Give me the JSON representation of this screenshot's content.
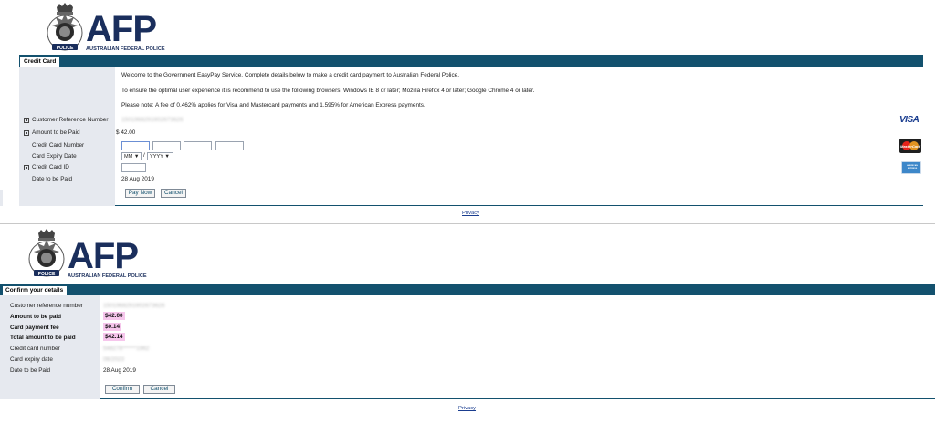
{
  "colors": {
    "brand_navy": "#1a2e5c",
    "tab_bar": "#13516e",
    "left_column": "#e6e9ef",
    "highlight": "#f6c6ec",
    "link": "#1a3d8f"
  },
  "logo": {
    "abbr": "AFP",
    "full": "AUSTRALIAN FEDERAL POLICE",
    "crest_label": "POLICE",
    "icon": "afp-crest-icon"
  },
  "payment_form": {
    "tab_label": "Credit Card",
    "info": [
      "Welcome to the Government EasyPay Service. Complete details below to make a credit card payment to Australian Federal Police.",
      "To ensure the optimal user experience it is recommend to use the following browsers: Windows IE 8 or later; Mozilla Firefox 4 or later; Google Chrome 4 or later.",
      "Please note: A fee of 0.462% applies for Visa and Mastercard payments and 1.595% for American Express payments."
    ],
    "fields": {
      "customer_reference": {
        "label": "Customer Reference Number",
        "value": "1501968291902673626"
      },
      "amount": {
        "label": "Amount to be Paid",
        "value": "$ 42.00"
      },
      "card_number": {
        "label": "Credit Card Number"
      },
      "expiry": {
        "label": "Card Expiry Date",
        "month_placeholder": "MM",
        "year_placeholder": "YYYY",
        "separator": "/"
      },
      "card_id": {
        "label": "Credit Card ID"
      },
      "date": {
        "label": "Date to be Paid",
        "value": "28 Aug 2019"
      }
    },
    "buttons": {
      "pay_now": "Pay Now",
      "cancel": "Cancel"
    },
    "cards": {
      "visa": "VISA",
      "mastercard": "MasterCard",
      "amex": "AMERICAN EXPRESS"
    },
    "privacy": "Privacy"
  },
  "confirm": {
    "tab_label": "Confirm your details",
    "rows": {
      "customer_reference": {
        "label": "Customer reference number",
        "value": "1501968291902673626"
      },
      "amount": {
        "label": "Amount to be paid",
        "value": "$42.00"
      },
      "fee": {
        "label": "Card payment fee",
        "value": "$0.14"
      },
      "total": {
        "label": "Total amount to be paid",
        "value": "$42.14"
      },
      "card_number": {
        "label": "Credit card number",
        "value": "548278******1962"
      },
      "expiry": {
        "label": "Card expiry date",
        "value": "06/2023"
      },
      "date": {
        "label": "Date to be Paid",
        "value": "28 Aug 2019"
      }
    },
    "buttons": {
      "confirm": "Confirm",
      "cancel": "Cancel"
    },
    "privacy": "Privacy"
  }
}
